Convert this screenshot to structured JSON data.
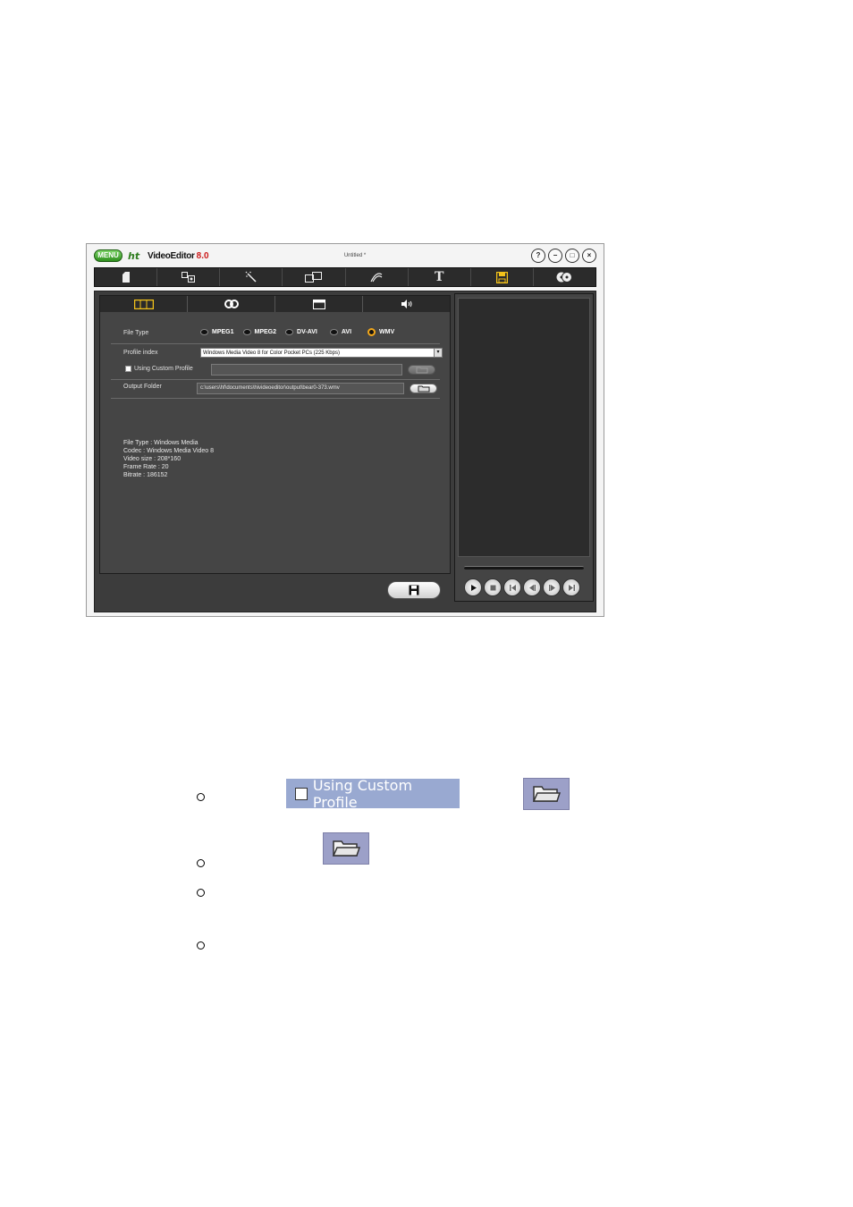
{
  "window": {
    "menu_label": "MENU",
    "logo_mark": "ht",
    "logo_name": "VideoEditor",
    "logo_version": "8.0",
    "document_title": "Untitled *",
    "buttons": [
      "?",
      "−",
      "□",
      "×"
    ]
  },
  "toolbar": {
    "items": [
      {
        "name": "file-icon"
      },
      {
        "name": "media-icon"
      },
      {
        "name": "magic-wand-icon"
      },
      {
        "name": "transition-icon"
      },
      {
        "name": "effect-icon"
      },
      {
        "name": "text-icon",
        "label": "T"
      },
      {
        "name": "save-output-icon",
        "active": true
      },
      {
        "name": "disc-burn-icon"
      }
    ]
  },
  "subtabs": [
    {
      "name": "video-format-tab",
      "active": true
    },
    {
      "name": "audio-codec-tab"
    },
    {
      "name": "image-tab"
    },
    {
      "name": "sound-tab"
    }
  ],
  "settings": {
    "file_type_label": "File Type",
    "file_types": [
      "MPEG1",
      "MPEG2",
      "DV-AVI",
      "AVI",
      "WMV"
    ],
    "selected_file_type": "WMV",
    "profile_index_label": "Profile index",
    "profile_value": "Windows Media Video 8 for Color Pocket PCs (225 Kbps)",
    "custom_profile_label": "Using Custom Profile",
    "custom_profile_checked": false,
    "output_folder_label": "Output Folder",
    "output_folder_value": "c:\\users\\hf\\documents\\hivideoeditor\\output\\bear0-373.wmv"
  },
  "info": {
    "file_type": "File Type : Windows Media",
    "codec": "Codec : Windows Media Video 8",
    "video_size": "Video size : 208*160",
    "frame_rate": "Frame Rate : 20",
    "bitrate": "Bitrate : 186152"
  },
  "doc": {
    "custom_profile_image_label": "Using Custom Profile"
  },
  "colors": {
    "accent": "#f3c21a",
    "panel": "#454545",
    "dark": "#2b2b2b"
  }
}
